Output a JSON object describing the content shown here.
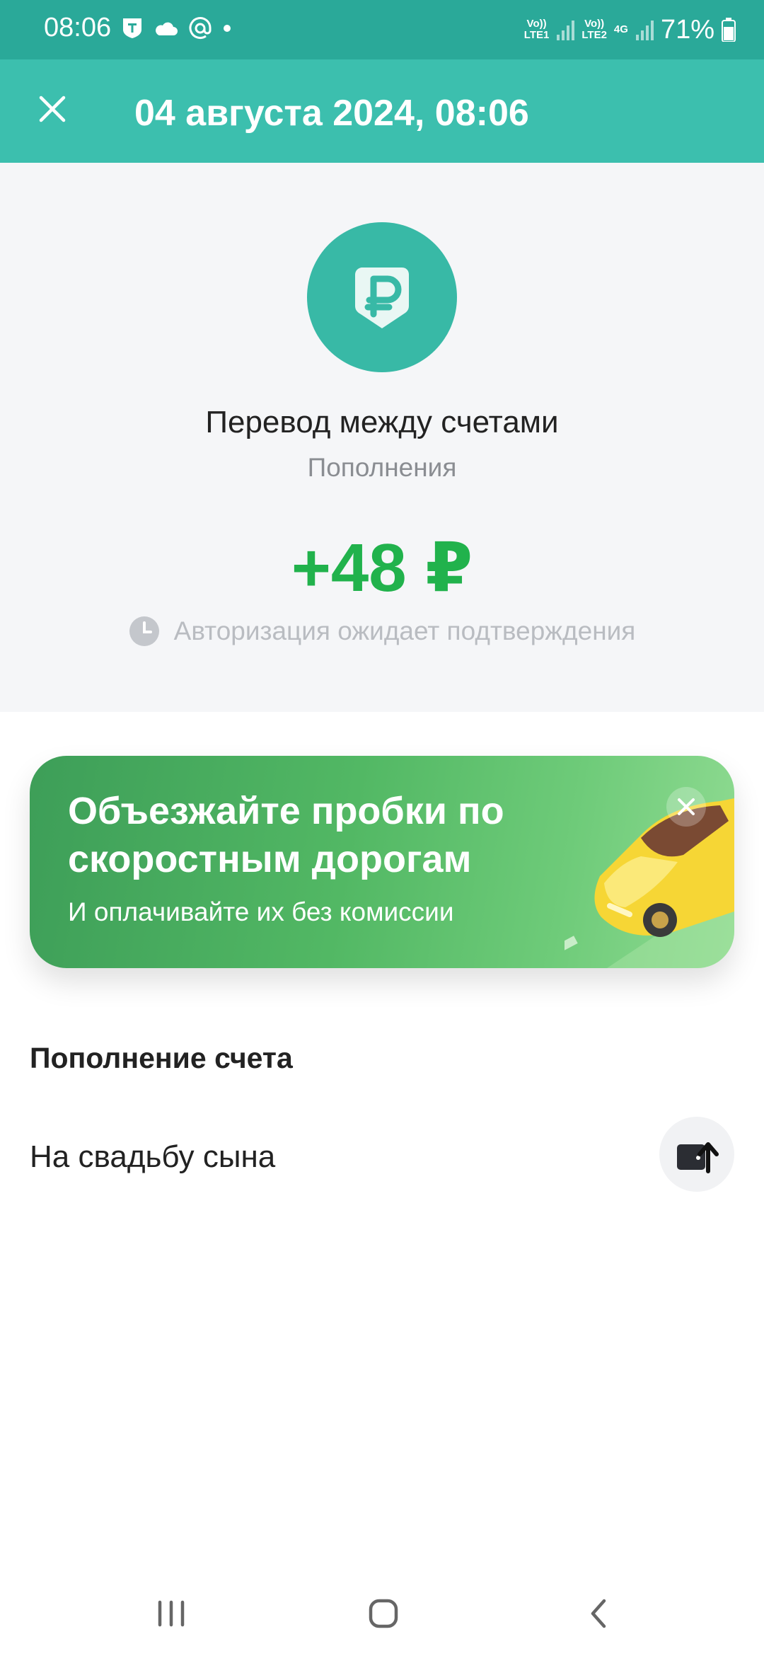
{
  "status_bar": {
    "time": "08:06",
    "sim1_label": "Vo))\nLTE1",
    "sim2_label": "Vo))\nLTE2",
    "network": "4G",
    "battery": "71%",
    "icons": [
      "tinkoff-icon",
      "cloud-icon",
      "at-icon",
      "dot-icon",
      "signal-icon",
      "battery-icon"
    ]
  },
  "header": {
    "title": "04 августа 2024, 08:06"
  },
  "operation": {
    "title": "Перевод между счетами",
    "category": "Пополнения",
    "amount": "+48 ₽",
    "status": "Авторизация ожидает подтверждения"
  },
  "banner": {
    "title": "Объезжайте пробки по скоростным дорогам",
    "subtitle": "И оплачивайте их без комиссии"
  },
  "details": {
    "section_title": "Пополнение счета",
    "account_name": "На свадьбу сына"
  },
  "colors": {
    "header_bg": "#3cbfae",
    "status_bg": "#2aa999",
    "amount_green": "#21b24c",
    "accent_teal": "#38b9a6"
  }
}
